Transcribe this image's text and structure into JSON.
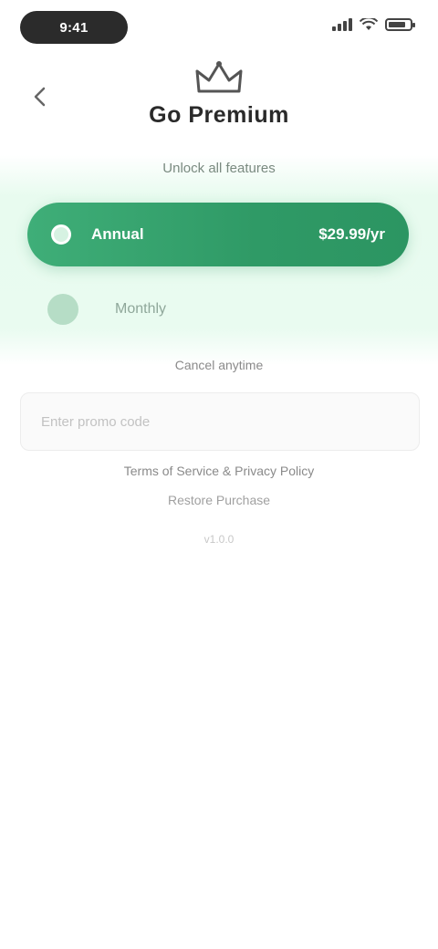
{
  "status_bar": {
    "time": "9:41",
    "battery_level": 0.8
  },
  "header": {
    "back_icon": "chevron-left-icon",
    "logo_icon": "crown-icon",
    "title": "Go Premium",
    "subtitle": "Unlock all features"
  },
  "plans": {
    "primary": {
      "name": "Annual",
      "price": "$29.99/yr",
      "selected": true
    },
    "secondary": {
      "name": "Monthly",
      "selected": false
    }
  },
  "note": "Cancel anytime",
  "promo": {
    "placeholder": "Enter promo code",
    "value": ""
  },
  "links": {
    "terms": "Terms of Service & Privacy Policy",
    "restore": "Restore Purchase"
  },
  "footer": "v1.0.0",
  "colors": {
    "accent": "#2f9a66",
    "accent_light": "#e8fbef"
  }
}
